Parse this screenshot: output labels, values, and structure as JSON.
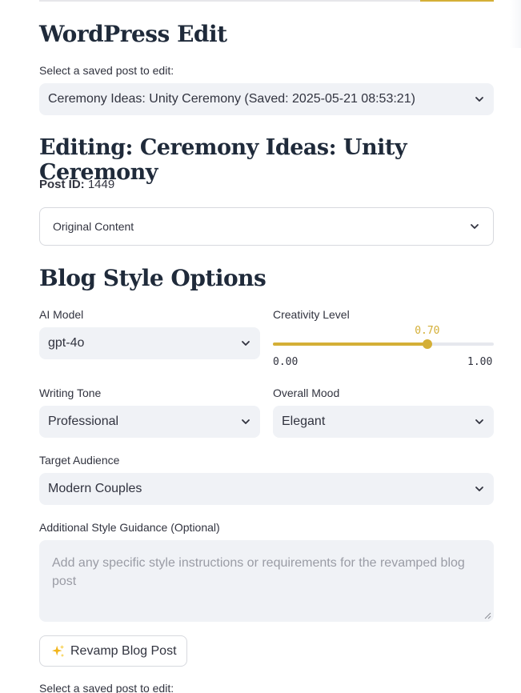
{
  "page_title": "WordPress Edit",
  "post_select": {
    "label": "Select a saved post to edit:",
    "value": "Ceremony Ideas: Unity Ceremony (Saved: 2025-05-21 08:53:21)"
  },
  "editing_title": "Editing: Ceremony Ideas: Unity Ceremony",
  "post_id": {
    "label": "Post ID:",
    "value": "1449"
  },
  "original_content": {
    "label": "Original Content"
  },
  "style_options": {
    "title": "Blog Style Options",
    "ai_model": {
      "label": "AI Model",
      "value": "gpt-4o"
    },
    "creativity": {
      "label": "Creativity Level",
      "value": "0.70",
      "min": "0.00",
      "max": "1.00",
      "fraction": 0.7
    },
    "writing_tone": {
      "label": "Writing Tone",
      "value": "Professional"
    },
    "overall_mood": {
      "label": "Overall Mood",
      "value": "Elegant"
    },
    "target_audience": {
      "label": "Target Audience",
      "value": "Modern Couples"
    },
    "guidance": {
      "label": "Additional Style Guidance (Optional)",
      "placeholder": "Add any specific style instructions or requirements for the revamped blog post"
    }
  },
  "revamp_button": {
    "label": "Revamp Blog Post",
    "icon": "sparkles-icon"
  },
  "footer_label": "Select a saved post to edit:",
  "colors": {
    "accent": "#d4af37",
    "input_bg": "#f0f2f6",
    "heading": "#1f2a3a"
  }
}
